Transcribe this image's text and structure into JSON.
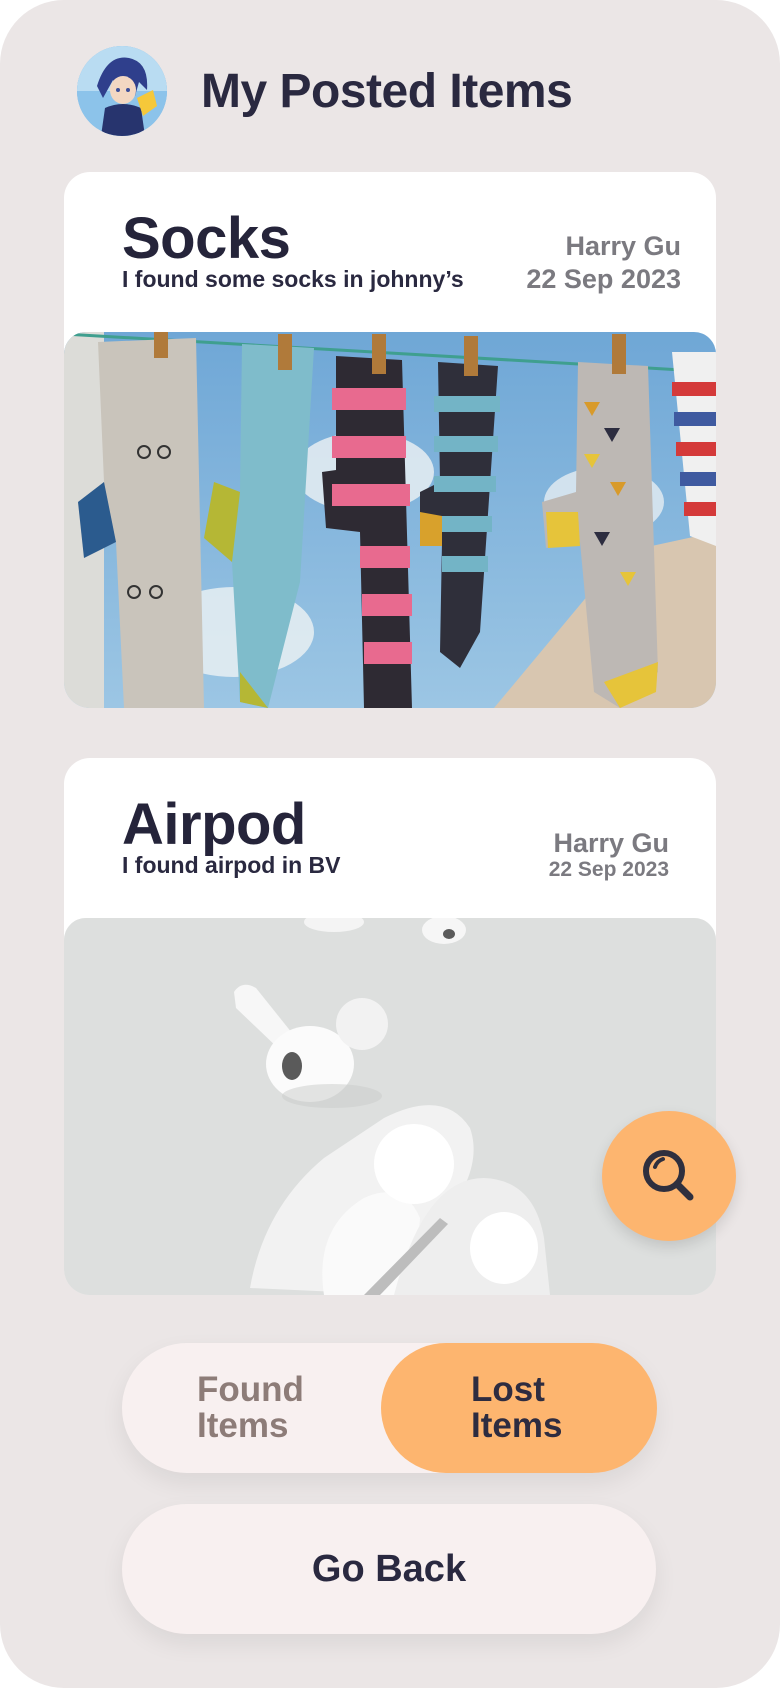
{
  "header": {
    "title": "My Posted Items",
    "avatar_icon": "anime-character-avatar"
  },
  "posts": [
    {
      "title": "Socks",
      "description": "I found some socks in johnny’s",
      "author": "Harry Gu",
      "date": "22 Sep 2023",
      "image": "socks-on-clothesline"
    },
    {
      "title": "Airpod",
      "description": "I found airpod in BV",
      "author": "Harry Gu",
      "date": "22 Sep 2023",
      "image": "airpods-and-case"
    }
  ],
  "fab": {
    "icon": "search-icon"
  },
  "toggle": {
    "found_label": "Found Items",
    "lost_label": "Lost Items",
    "selected": "lost"
  },
  "buttons": {
    "go_back": "Go Back"
  },
  "colors": {
    "background": "#ebe6e6",
    "accent": "#fdb56f",
    "card": "#ffffff",
    "text_dark": "#2a2940",
    "text_muted": "#7b7a80",
    "pill": "#f8f0f0",
    "found_text": "#8d7c78"
  }
}
